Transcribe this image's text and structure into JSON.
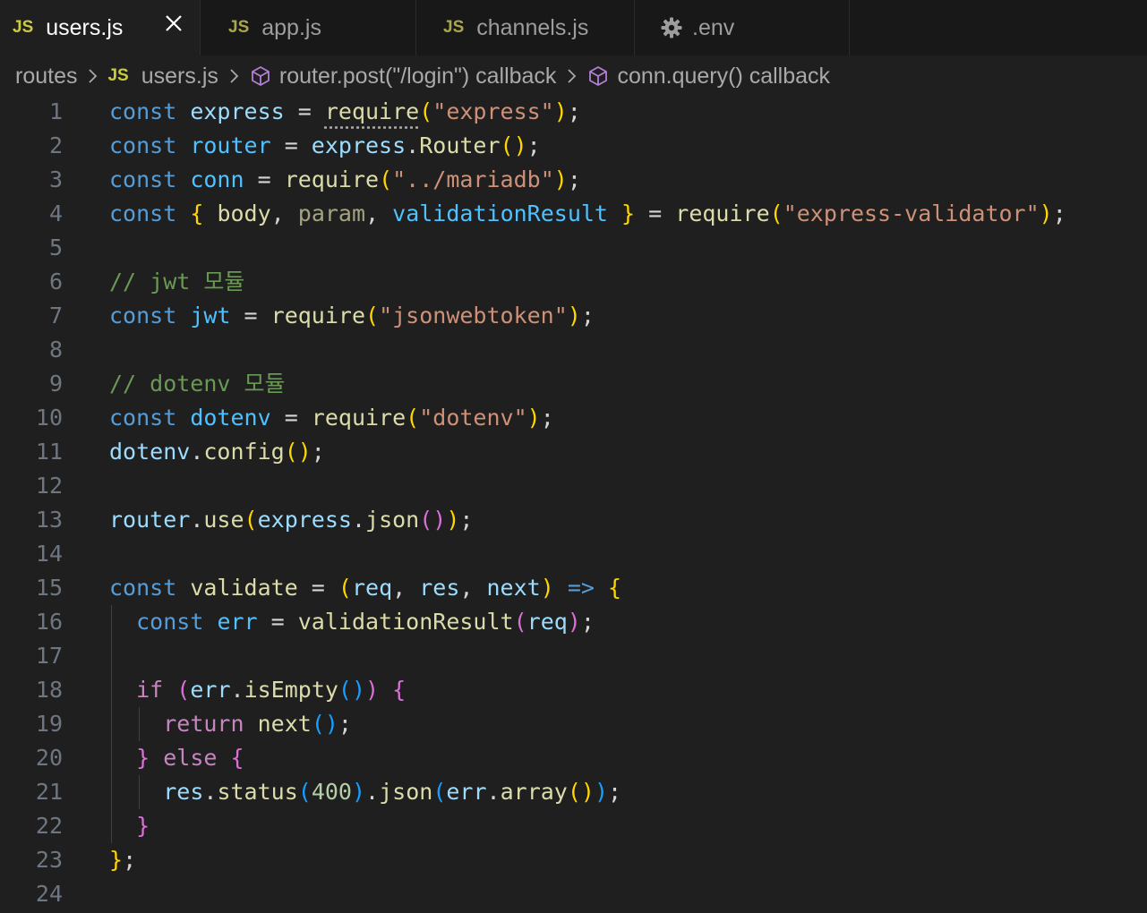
{
  "tabs": [
    {
      "label": "users.js",
      "icon": "js-file-icon",
      "icon_text": "JS",
      "active": true
    },
    {
      "label": "app.js",
      "icon": "js-file-icon",
      "icon_text": "JS",
      "active": false
    },
    {
      "label": "channels.js",
      "icon": "js-file-icon",
      "icon_text": "JS",
      "active": false
    },
    {
      "label": ".env",
      "icon": "gear-icon",
      "icon_text": "",
      "active": false
    }
  ],
  "breadcrumb": {
    "folder": "routes",
    "file_icon_text": "JS",
    "file": "users.js",
    "symbol1": "router.post(\"/login\") callback",
    "symbol2": "conn.query() callback"
  },
  "colors": {
    "editor_bg": "#1f1f1f",
    "tab_bar_bg": "#181818",
    "keyword": "#569cd6",
    "variable": "#9cdcfe",
    "function": "#dcdcaa",
    "string": "#ce9178",
    "comment": "#6a9955",
    "control": "#c586c0",
    "bracket_gold": "#ffd700",
    "bracket_purple": "#da70d6",
    "bracket_blue": "#179fff",
    "js_icon": "#cbcb41"
  },
  "code": {
    "lines": [
      {
        "n": "1",
        "tokens": [
          [
            "kw",
            "const"
          ],
          [
            "pun",
            " "
          ],
          [
            "var",
            "express"
          ],
          [
            "pun",
            " = "
          ],
          [
            "fnsq",
            "require"
          ],
          [
            "b1",
            "("
          ],
          [
            "str",
            "\"express\""
          ],
          [
            "b1",
            ")"
          ],
          [
            "pun",
            ";"
          ]
        ]
      },
      {
        "n": "2",
        "tokens": [
          [
            "kw",
            "const"
          ],
          [
            "pun",
            " "
          ],
          [
            "cst",
            "router"
          ],
          [
            "pun",
            " = "
          ],
          [
            "var",
            "express"
          ],
          [
            "pun",
            "."
          ],
          [
            "fn",
            "Router"
          ],
          [
            "b1",
            "()"
          ],
          [
            "pun",
            ";"
          ]
        ]
      },
      {
        "n": "3",
        "tokens": [
          [
            "kw",
            "const"
          ],
          [
            "pun",
            " "
          ],
          [
            "cst",
            "conn"
          ],
          [
            "pun",
            " = "
          ],
          [
            "fn",
            "require"
          ],
          [
            "b1",
            "("
          ],
          [
            "str",
            "\"../mariadb\""
          ],
          [
            "b1",
            ")"
          ],
          [
            "pun",
            ";"
          ]
        ]
      },
      {
        "n": "4",
        "tokens": [
          [
            "kw",
            "const"
          ],
          [
            "pun",
            " "
          ],
          [
            "b1",
            "{"
          ],
          [
            "pun",
            " "
          ],
          [
            "fn",
            "body"
          ],
          [
            "pun",
            ", "
          ],
          [
            "fnd",
            "param"
          ],
          [
            "pun",
            ", "
          ],
          [
            "cst",
            "validationResult"
          ],
          [
            "pun",
            " "
          ],
          [
            "b1",
            "}"
          ],
          [
            "pun",
            " = "
          ],
          [
            "fn",
            "require"
          ],
          [
            "b1",
            "("
          ],
          [
            "str",
            "\"express-validator\""
          ],
          [
            "b1",
            ")"
          ],
          [
            "pun",
            ";"
          ]
        ]
      },
      {
        "n": "5",
        "tokens": []
      },
      {
        "n": "6",
        "tokens": [
          [
            "cmt",
            "// jwt 모듈"
          ]
        ]
      },
      {
        "n": "7",
        "tokens": [
          [
            "kw",
            "const"
          ],
          [
            "pun",
            " "
          ],
          [
            "cst",
            "jwt"
          ],
          [
            "pun",
            " = "
          ],
          [
            "fn",
            "require"
          ],
          [
            "b1",
            "("
          ],
          [
            "str",
            "\"jsonwebtoken\""
          ],
          [
            "b1",
            ")"
          ],
          [
            "pun",
            ";"
          ]
        ]
      },
      {
        "n": "8",
        "tokens": []
      },
      {
        "n": "9",
        "tokens": [
          [
            "cmt",
            "// dotenv 모듈"
          ]
        ]
      },
      {
        "n": "10",
        "tokens": [
          [
            "kw",
            "const"
          ],
          [
            "pun",
            " "
          ],
          [
            "cst",
            "dotenv"
          ],
          [
            "pun",
            " = "
          ],
          [
            "fn",
            "require"
          ],
          [
            "b1",
            "("
          ],
          [
            "str",
            "\"dotenv\""
          ],
          [
            "b1",
            ")"
          ],
          [
            "pun",
            ";"
          ]
        ]
      },
      {
        "n": "11",
        "tokens": [
          [
            "var",
            "dotenv"
          ],
          [
            "pun",
            "."
          ],
          [
            "fn",
            "config"
          ],
          [
            "b1",
            "()"
          ],
          [
            "pun",
            ";"
          ]
        ]
      },
      {
        "n": "12",
        "tokens": []
      },
      {
        "n": "13",
        "tokens": [
          [
            "var",
            "router"
          ],
          [
            "pun",
            "."
          ],
          [
            "fn",
            "use"
          ],
          [
            "b1",
            "("
          ],
          [
            "var",
            "express"
          ],
          [
            "pun",
            "."
          ],
          [
            "fn",
            "json"
          ],
          [
            "b2",
            "()"
          ],
          [
            "b1",
            ")"
          ],
          [
            "pun",
            ";"
          ]
        ]
      },
      {
        "n": "14",
        "tokens": []
      },
      {
        "n": "15",
        "tokens": [
          [
            "kw",
            "const"
          ],
          [
            "pun",
            " "
          ],
          [
            "fn",
            "validate"
          ],
          [
            "pun",
            " = "
          ],
          [
            "b1",
            "("
          ],
          [
            "var",
            "req"
          ],
          [
            "pun",
            ", "
          ],
          [
            "var",
            "res"
          ],
          [
            "pun",
            ", "
          ],
          [
            "var",
            "next"
          ],
          [
            "b1",
            ")"
          ],
          [
            "pun",
            " "
          ],
          [
            "kw",
            "=>"
          ],
          [
            "pun",
            " "
          ],
          [
            "b1",
            "{"
          ]
        ]
      },
      {
        "n": "16",
        "tokens": [
          [
            "pun",
            "  "
          ],
          [
            "kw",
            "const"
          ],
          [
            "pun",
            " "
          ],
          [
            "cst",
            "err"
          ],
          [
            "pun",
            " = "
          ],
          [
            "fn",
            "validationResult"
          ],
          [
            "b2",
            "("
          ],
          [
            "var",
            "req"
          ],
          [
            "b2",
            ")"
          ],
          [
            "pun",
            ";"
          ]
        ]
      },
      {
        "n": "17",
        "tokens": []
      },
      {
        "n": "18",
        "tokens": [
          [
            "pun",
            "  "
          ],
          [
            "ctl",
            "if"
          ],
          [
            "pun",
            " "
          ],
          [
            "b2",
            "("
          ],
          [
            "var",
            "err"
          ],
          [
            "pun",
            "."
          ],
          [
            "fn",
            "isEmpty"
          ],
          [
            "b3",
            "()"
          ],
          [
            "b2",
            ")"
          ],
          [
            "pun",
            " "
          ],
          [
            "b2",
            "{"
          ]
        ]
      },
      {
        "n": "19",
        "tokens": [
          [
            "pun",
            "    "
          ],
          [
            "ctl",
            "return"
          ],
          [
            "pun",
            " "
          ],
          [
            "fn",
            "next"
          ],
          [
            "b3",
            "()"
          ],
          [
            "pun",
            ";"
          ]
        ]
      },
      {
        "n": "20",
        "tokens": [
          [
            "pun",
            "  "
          ],
          [
            "b2",
            "}"
          ],
          [
            "pun",
            " "
          ],
          [
            "ctl",
            "else"
          ],
          [
            "pun",
            " "
          ],
          [
            "b2",
            "{"
          ]
        ]
      },
      {
        "n": "21",
        "tokens": [
          [
            "pun",
            "    "
          ],
          [
            "var",
            "res"
          ],
          [
            "pun",
            "."
          ],
          [
            "fn",
            "status"
          ],
          [
            "b3",
            "("
          ],
          [
            "num",
            "400"
          ],
          [
            "b3",
            ")"
          ],
          [
            "pun",
            "."
          ],
          [
            "fn",
            "json"
          ],
          [
            "b3",
            "("
          ],
          [
            "var",
            "err"
          ],
          [
            "pun",
            "."
          ],
          [
            "fn",
            "array"
          ],
          [
            "b1",
            "()"
          ],
          [
            "b3",
            ")"
          ],
          [
            "pun",
            ";"
          ]
        ]
      },
      {
        "n": "22",
        "tokens": [
          [
            "pun",
            "  "
          ],
          [
            "b2",
            "}"
          ]
        ]
      },
      {
        "n": "23",
        "tokens": [
          [
            "b1",
            "}"
          ],
          [
            "pun",
            ";"
          ]
        ]
      },
      {
        "n": "24",
        "tokens": []
      }
    ]
  }
}
